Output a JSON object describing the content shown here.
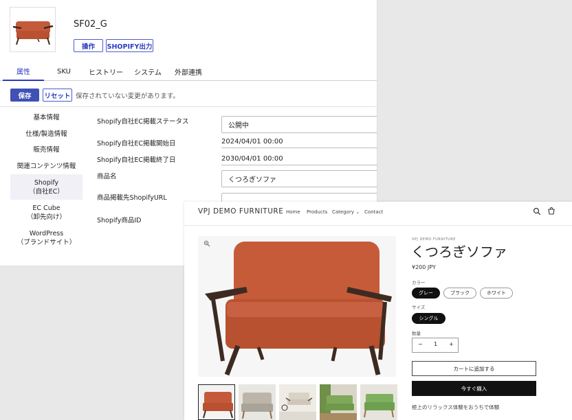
{
  "admin": {
    "product_code": "SF02_G",
    "header_buttons": [
      "操作",
      "SHOPIFY出力"
    ],
    "tabs": [
      "属性",
      "SKU",
      "ヒストリー",
      "システム",
      "外部連携"
    ],
    "save_label": "保存",
    "reset_label": "リセット",
    "unsaved_message": "保存されていない変更があります。",
    "sidebar": [
      {
        "label": "基本情報"
      },
      {
        "label": "仕様/製造情報"
      },
      {
        "label": "販売情報"
      },
      {
        "label": "関連コンテンツ情報"
      },
      {
        "label": "Shopify\n（自社EC）"
      },
      {
        "label": "EC Cube\n（卸先向け）"
      },
      {
        "label": "WordPress\n（ブランドサイト）"
      }
    ],
    "fields": {
      "status_label": "Shopify自社EC掲載ステータス",
      "status_value": "公開中",
      "start_label": "Shopify自社EC掲載開始日",
      "start_value": "2024/04/01 00:00",
      "end_label": "Shopify自社EC掲載終了日",
      "end_value": "2030/04/01 00:00",
      "name_label": "商品名",
      "name_value": "くつろぎソファ",
      "url_label": "商品掲載先ShopifyURL",
      "id_label": "Shopify商品ID"
    }
  },
  "store": {
    "brand": "VPJ DEMO FURNITURE",
    "nav": [
      "Home",
      "Products",
      "Category ⌄",
      "Contact"
    ],
    "vendor": "VPJ DEMO FURNITURE",
    "title": "くつろぎソファ",
    "price": "¥200 JPY",
    "color_label": "カラー",
    "colors": [
      "グレー",
      "ブラック",
      "ホワイト"
    ],
    "size_label": "サイズ",
    "sizes": [
      "シングル"
    ],
    "qty_label": "数量",
    "qty_minus": "−",
    "qty_value": "1",
    "qty_plus": "+",
    "cart_label": "カートに追加する",
    "buy_label": "今すぐ購入",
    "description": "極上のリラックス体験をおうちで体験",
    "icons": [
      "search-icon",
      "cart-icon",
      "zoom-icon"
    ],
    "colors_hex": {
      "sofa": "#c45a3a",
      "frame": "#3d2b22",
      "gray": "#bdb5aa",
      "green": "#7fa85a"
    }
  }
}
